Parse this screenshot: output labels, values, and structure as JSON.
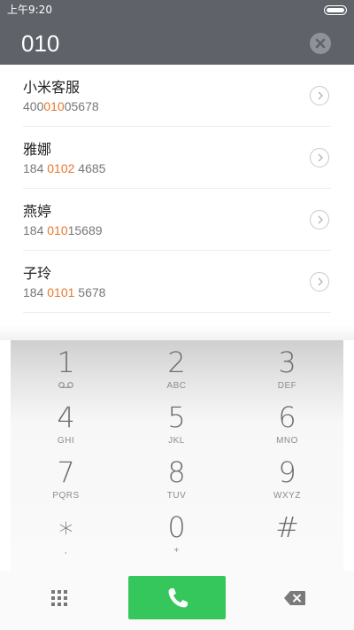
{
  "status_bar": {
    "time": "上午9:20",
    "battery_level": 1.0
  },
  "dial": {
    "number": "010",
    "clear_icon": "clear-circle-icon"
  },
  "contacts": [
    {
      "name": "小米客服",
      "number_pre": "400",
      "number_hl": "010",
      "number_post": "05678"
    },
    {
      "name": "雅娜",
      "number_pre": "184 ",
      "number_hl": "0102",
      "number_post": " 4685"
    },
    {
      "name": "燕婷",
      "number_pre": "184 ",
      "number_hl": "010",
      "number_post": "15689"
    },
    {
      "name": "子玲",
      "number_pre": "184 ",
      "number_hl": "0101",
      "number_post": " 5678"
    }
  ],
  "keypad": [
    {
      "digit": "1",
      "letters": ""
    },
    {
      "digit": "2",
      "letters": "ABC"
    },
    {
      "digit": "3",
      "letters": "DEF"
    },
    {
      "digit": "4",
      "letters": "GHI"
    },
    {
      "digit": "5",
      "letters": "JKL"
    },
    {
      "digit": "6",
      "letters": "MNO"
    },
    {
      "digit": "7",
      "letters": "PQRS"
    },
    {
      "digit": "8",
      "letters": "TUV"
    },
    {
      "digit": "9",
      "letters": "WXYZ"
    },
    {
      "digit": "∗",
      "letters": ","
    },
    {
      "digit": "0",
      "letters": "+"
    },
    {
      "digit": "#",
      "letters": ""
    }
  ],
  "colors": {
    "header": "#5f6369",
    "highlight": "#e8762b",
    "call_button": "#35c75b"
  },
  "icons": {
    "keypad_toggle": "grid-icon",
    "call": "phone-icon",
    "backspace": "backspace-icon",
    "voicemail": "voicemail-icon",
    "detail": "chevron-right-icon"
  }
}
